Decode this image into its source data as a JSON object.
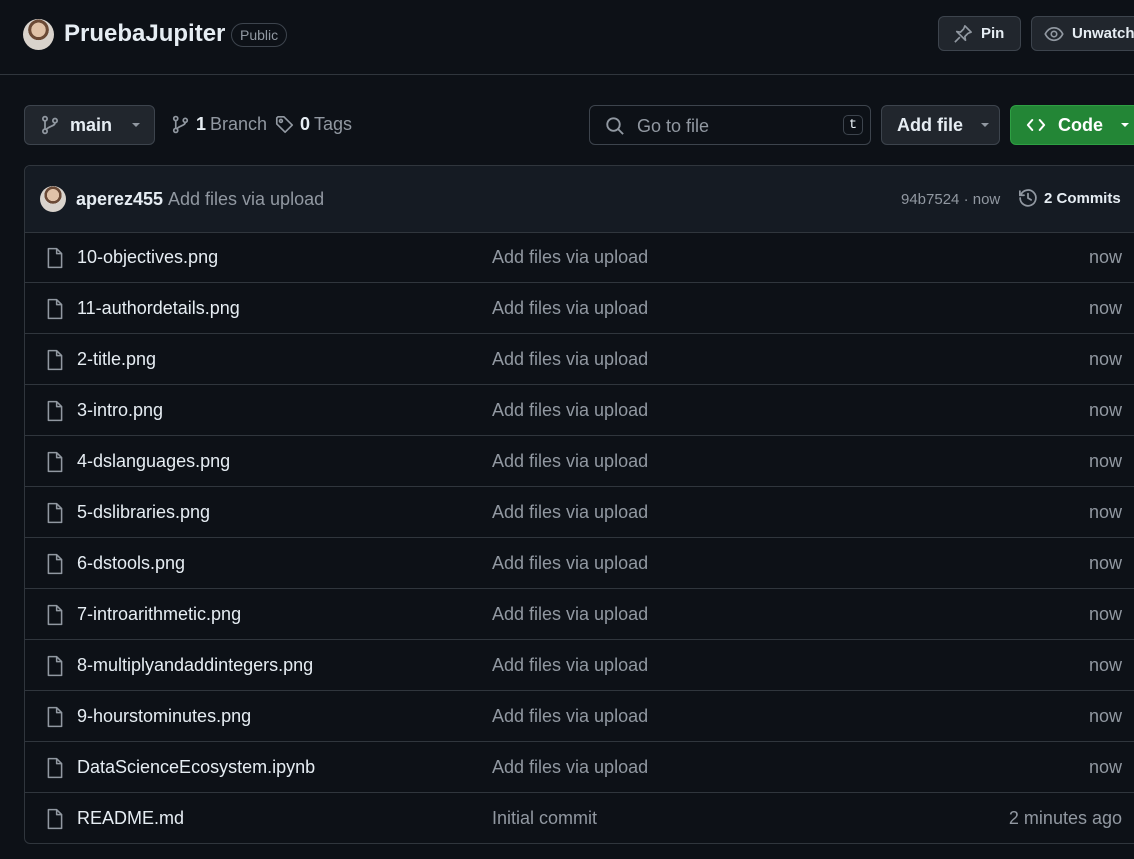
{
  "repo": {
    "name": "PruebaJupiter",
    "visibility": "Public",
    "pin_label": "Pin",
    "unwatch_label": "Unwatch"
  },
  "toolbar": {
    "branch": "main",
    "branch_count": "1",
    "branch_label": "Branch",
    "tag_count": "0",
    "tag_label": "Tags",
    "search_placeholder": "Go to file",
    "search_shortcut": "t",
    "add_file_label": "Add file",
    "code_label": "Code"
  },
  "commit": {
    "author": "aperez455",
    "message": "Add files via upload",
    "hash_time": "94b7524 · now",
    "commits_label": "2 Commits"
  },
  "files": [
    {
      "name": "10-objectives.png",
      "message": "Add files via upload",
      "time": "now"
    },
    {
      "name": "11-authordetails.png",
      "message": "Add files via upload",
      "time": "now"
    },
    {
      "name": "2-title.png",
      "message": "Add files via upload",
      "time": "now"
    },
    {
      "name": "3-intro.png",
      "message": "Add files via upload",
      "time": "now"
    },
    {
      "name": "4-dslanguages.png",
      "message": "Add files via upload",
      "time": "now"
    },
    {
      "name": "5-dslibraries.png",
      "message": "Add files via upload",
      "time": "now"
    },
    {
      "name": "6-dstools.png",
      "message": "Add files via upload",
      "time": "now"
    },
    {
      "name": "7-introarithmetic.png",
      "message": "Add files via upload",
      "time": "now"
    },
    {
      "name": "8-multiplyandaddintegers.png",
      "message": "Add files via upload",
      "time": "now"
    },
    {
      "name": "9-hourstominutes.png",
      "message": "Add files via upload",
      "time": "now"
    },
    {
      "name": "DataScienceEcosystem.ipynb",
      "message": "Add files via upload",
      "time": "now"
    },
    {
      "name": "README.md",
      "message": "Initial commit",
      "time": "2 minutes ago"
    }
  ],
  "icons": {
    "file": "file-icon",
    "branch": "git-branch-icon",
    "tag": "tag-icon",
    "search": "search-icon",
    "pin": "pin-icon",
    "eye": "eye-icon",
    "history": "history-icon",
    "code": "code-icon"
  },
  "colors": {
    "background": "#0d1117",
    "accent_green": "#238636",
    "border": "#30363d",
    "muted_text": "#9198a1"
  }
}
